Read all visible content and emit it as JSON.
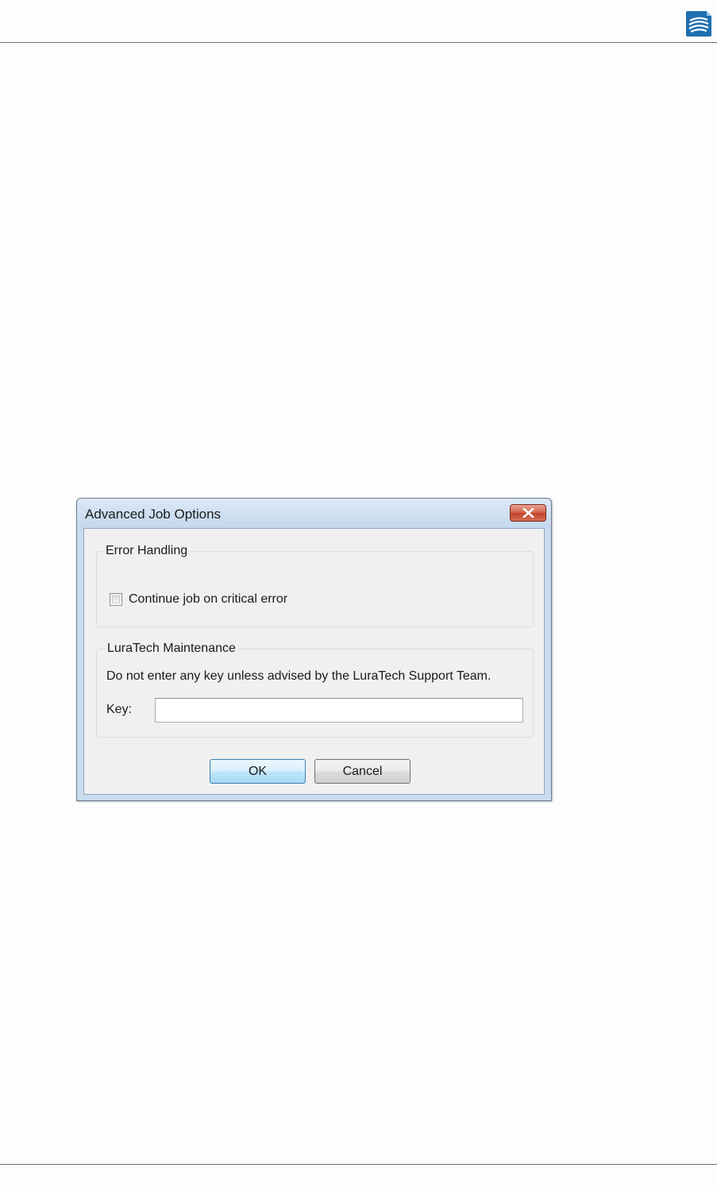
{
  "header": {
    "logo_icon": "luratech-logo-icon"
  },
  "dialog": {
    "title": "Advanced Job Options",
    "close_icon": "close-icon",
    "error_handling": {
      "legend": "Error Handling",
      "checkbox_label": "Continue job on critical error",
      "checked": false
    },
    "maintenance": {
      "legend": "LuraTech Maintenance",
      "notice": "Do not enter any key unless advised by the LuraTech Support Team.",
      "key_label": "Key:",
      "key_value": ""
    },
    "buttons": {
      "ok": "OK",
      "cancel": "Cancel"
    }
  },
  "colors": {
    "close_button": "#c2432b",
    "title_bar": "#c9dcef",
    "logo": "#1f6fb0"
  }
}
